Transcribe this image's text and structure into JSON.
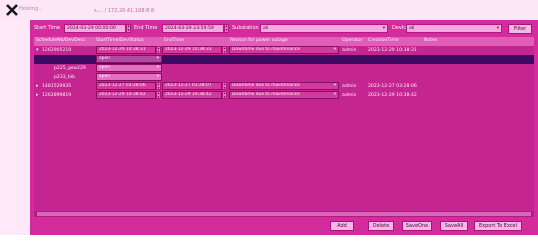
{
  "window": {
    "title": "Hosting...",
    "url": "s.... / 172.20.41.108:8 8"
  },
  "toolbar": {
    "start_time_label": "Start Time",
    "start_time_value": "2024-03-29 00:00:00",
    "end_time_label": "End Time",
    "end_time_value": "2024-03-29 23:59:59",
    "substation_label": "Substation",
    "substation_value": "all",
    "device_label": "Device",
    "device_value": "all",
    "filter_label": "Filter",
    "extra_label": "Q"
  },
  "grid": {
    "columns": [
      "ScheduleNo/DevDesc",
      "StartTime/DevStatus",
      "EndTime",
      "Reason for power outage",
      "Operator",
      "CreationTime",
      "Notes"
    ],
    "rows": [
      {
        "kind": "parent",
        "id": "1262905219",
        "start": "2023-12-29 10:38:31",
        "end": "2023-12-29 10:38:31",
        "reason": "Downtime due to maintenance",
        "operator": "admin",
        "created": "2023-12-29 10:38:31"
      },
      {
        "kind": "child",
        "desc": "",
        "status": "open",
        "selected": true
      },
      {
        "kind": "child",
        "desc": "p225_gsw229",
        "status": "open",
        "selected": false
      },
      {
        "kind": "child",
        "desc": "p233_bib",
        "status": "open",
        "selected": false
      },
      {
        "kind": "parent",
        "id": "1481529935",
        "start": "2023-12-27 03:28:06",
        "end": "2023-12-27 03:28:07",
        "reason": "Downtime due to maintenance",
        "operator": "admin",
        "created": "2023-12-27 03:28:06"
      },
      {
        "kind": "parent",
        "id": "1262899819",
        "start": "2023-12-29 10:38:42",
        "end": "2023-12-29 10:38:42",
        "reason": "Downtime due to maintenance",
        "operator": "admin",
        "created": "2023-12-29 10:38:42"
      }
    ]
  },
  "actions": {
    "add": "Add",
    "delete": "Delete",
    "save_one": "SaveOne",
    "save_all": "SaveAll",
    "export": "Export To Excel",
    "extra": "Q"
  },
  "colors": {
    "panel": "#d42c9d",
    "selected_row": "#3d0c62",
    "accent": "#f7a8e0"
  },
  "icons": {
    "logo": "x-logo-icon",
    "expand": "triangle-right-icon",
    "dropdown": "chevron-down-icon",
    "spinner": "spin-updown-icon"
  }
}
